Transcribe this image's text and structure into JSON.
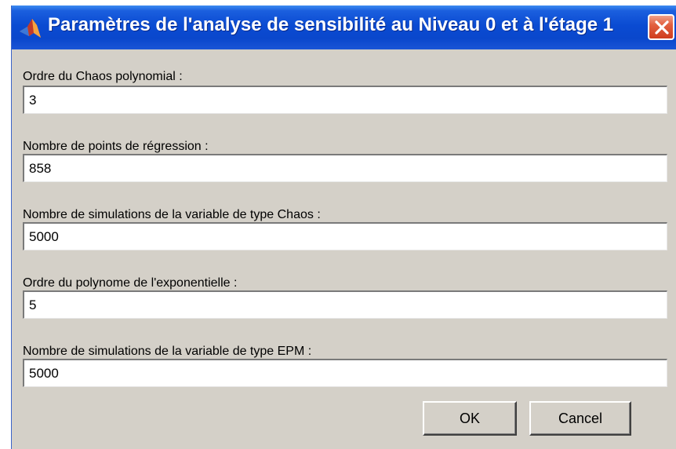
{
  "window": {
    "title": "Paramètres de l'analyse de sensibilité au Niveau 0 et à l'étage 1",
    "icon": "matlab-icon",
    "close_icon": "close-icon"
  },
  "fields": [
    {
      "label": "Ordre du Chaos polynomial :",
      "value": "3"
    },
    {
      "label": "Nombre de points de régression :",
      "value": "858"
    },
    {
      "label": "Nombre de simulations de la variable de type Chaos :",
      "value": "5000"
    },
    {
      "label": "Ordre du polynome de l'exponentielle :",
      "value": "5"
    },
    {
      "label": "Nombre de simulations de la variable de type EPM :",
      "value": "5000"
    }
  ],
  "buttons": {
    "ok_label": "OK",
    "cancel_label": "Cancel"
  }
}
